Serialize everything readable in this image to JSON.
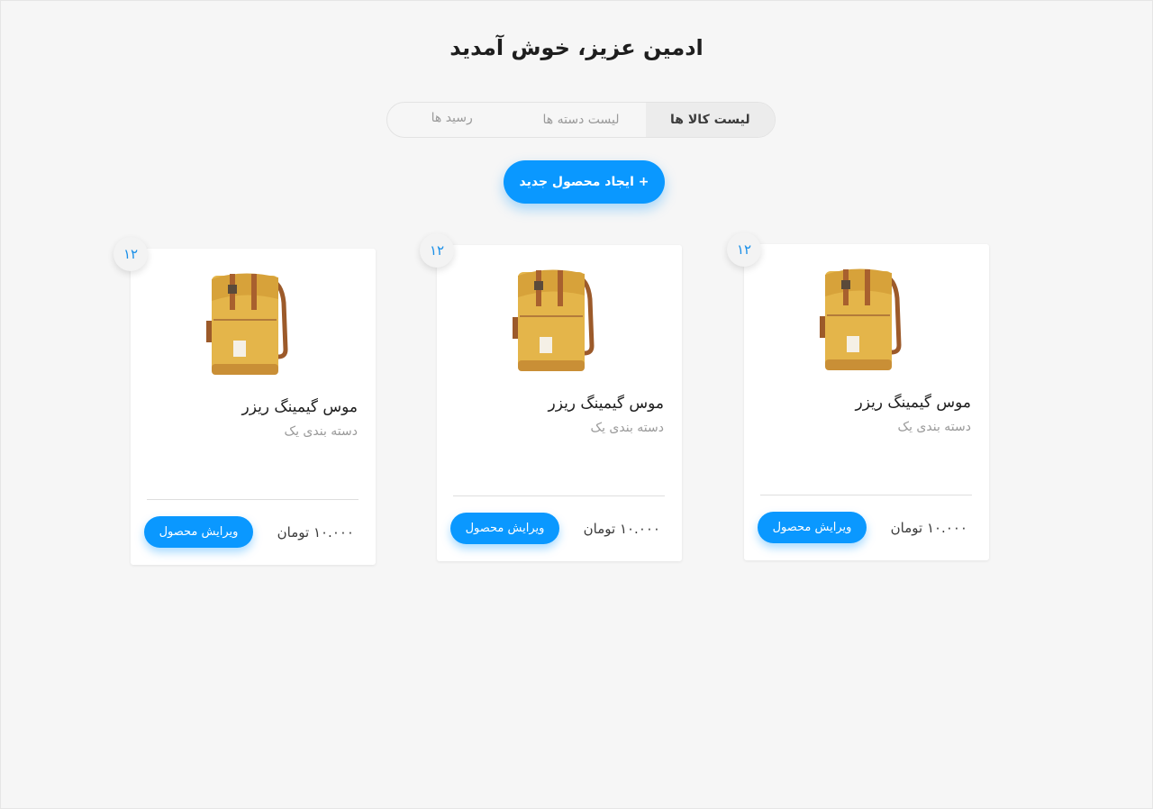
{
  "header": {
    "title": "ادمین عزیز، خوش آمدید"
  },
  "tabs": [
    {
      "label": "لیست کالا ها",
      "active": true
    },
    {
      "label": "لیست دسته ها",
      "active": false
    },
    {
      "label": "رسید ها",
      "active": false
    }
  ],
  "actions": {
    "create_label": "+ ایجاد محصول جدید"
  },
  "products": [
    {
      "badge": "۱۲",
      "name": "موس گیمینگ ریزر",
      "category": "دسته بندی یک",
      "price": "۱۰.۰۰۰ تومان",
      "edit_label": "ویرایش محصول",
      "image": "yellow-backpack-image"
    },
    {
      "badge": "۱۲",
      "name": "موس گیمینگ ریزر",
      "category": "دسته بندی یک",
      "price": "۱۰.۰۰۰ تومان",
      "edit_label": "ویرایش محصول",
      "image": "yellow-backpack-image"
    },
    {
      "badge": "۱۲",
      "name": "موس گیمینگ ریزر",
      "category": "دسته بندی یک",
      "price": "۱۰.۰۰۰ تومان",
      "edit_label": "ویرایش محصول",
      "image": "yellow-backpack-image"
    }
  ],
  "colors": {
    "accent": "#0a98ff",
    "background": "#f6f6f6",
    "badge_text": "#1a8fe8"
  }
}
